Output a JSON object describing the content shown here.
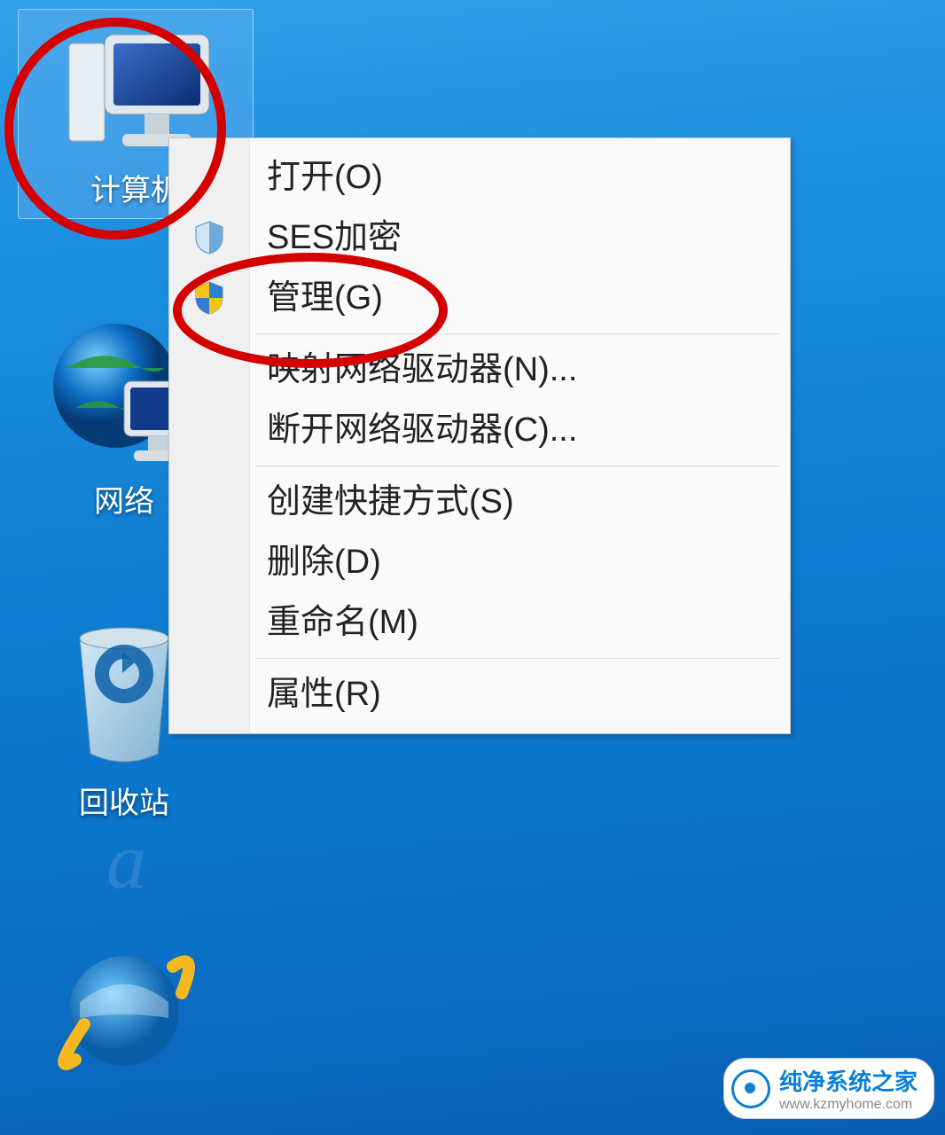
{
  "desktop": {
    "icons": {
      "computer": {
        "label": "计算机"
      },
      "network": {
        "label": "网络"
      },
      "recycle": {
        "label": "回收站"
      }
    }
  },
  "context_menu": {
    "items": [
      {
        "label": "打开(O)",
        "icon": null
      },
      {
        "label": "SES加密",
        "icon": "shield-blue"
      },
      {
        "label": "管理(G)",
        "icon": "shield-uac"
      },
      {
        "sep": true
      },
      {
        "label": "映射网络驱动器(N)...",
        "icon": null
      },
      {
        "label": "断开网络驱动器(C)...",
        "icon": null
      },
      {
        "sep": true
      },
      {
        "label": "创建快捷方式(S)",
        "icon": null
      },
      {
        "label": "删除(D)",
        "icon": null
      },
      {
        "label": "重命名(M)",
        "icon": null
      },
      {
        "sep": true
      },
      {
        "label": "属性(R)",
        "icon": null
      }
    ]
  },
  "watermark": {
    "brand": "纯净系统之家",
    "url": "www.kzmyhome.com"
  }
}
